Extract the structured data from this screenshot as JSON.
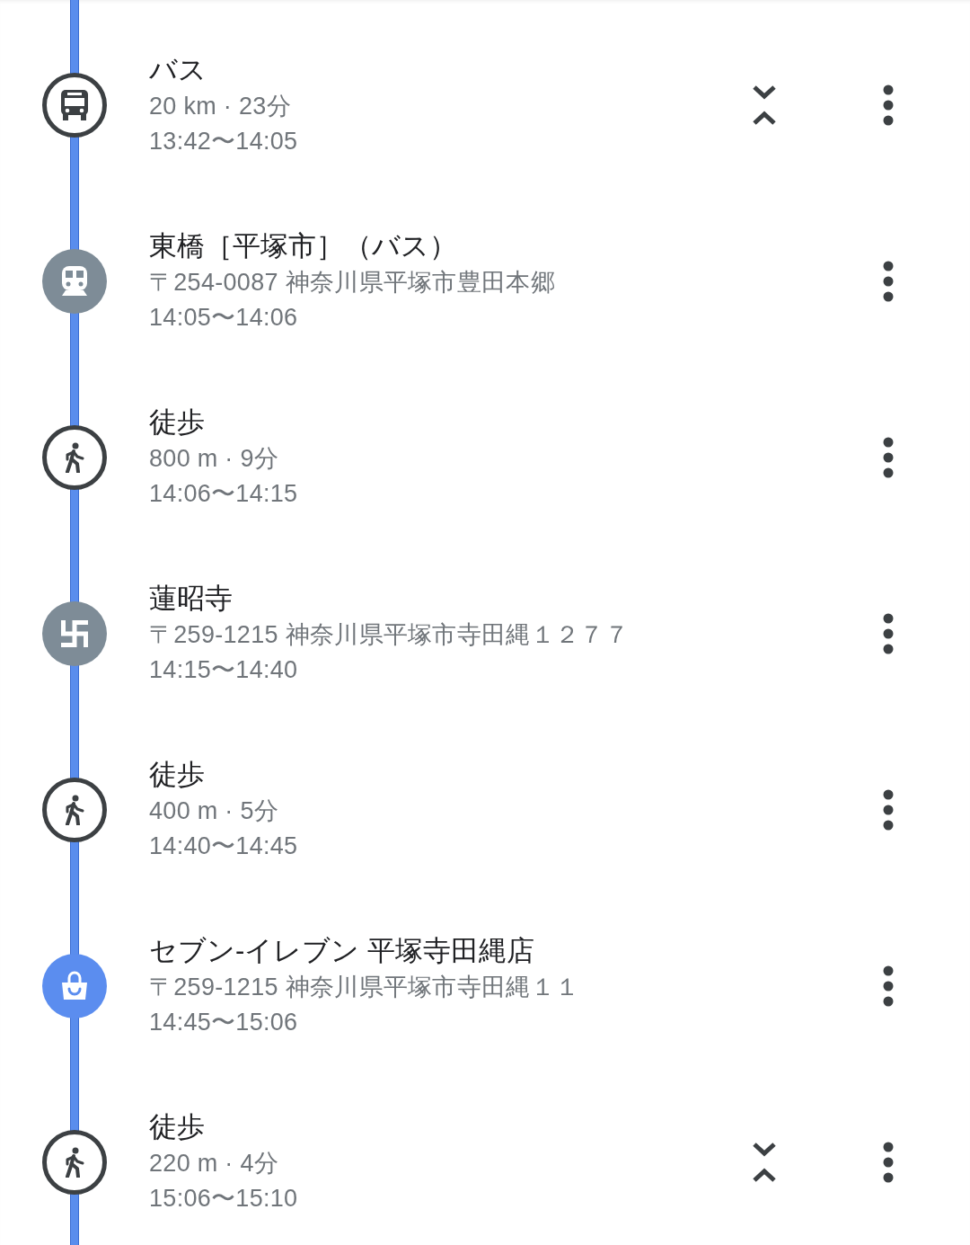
{
  "timeline": [
    {
      "kind": "bus",
      "title": "バス",
      "detail": "20 km · 23分",
      "time": "13:42〜14:05",
      "collapsible": true
    },
    {
      "kind": "station",
      "color": "#7e8c97",
      "title": "東橋［平塚市］（バス）",
      "detail": "〒254-0087 神奈川県平塚市豊田本郷",
      "time": "14:05〜14:06",
      "collapsible": false
    },
    {
      "kind": "walk",
      "title": "徒歩",
      "detail": "800 m · 9分",
      "time": "14:06〜14:15",
      "collapsible": false
    },
    {
      "kind": "temple",
      "color": "#7e8c97",
      "title": "蓮昭寺",
      "detail": "〒259-1215 神奈川県平塚市寺田縄１２７７",
      "time": "14:15〜14:40",
      "collapsible": false
    },
    {
      "kind": "walk",
      "title": "徒歩",
      "detail": "400 m · 5分",
      "time": "14:40〜14:45",
      "collapsible": false
    },
    {
      "kind": "shop",
      "color": "#5b8def",
      "title": "セブン-イレブン 平塚寺田縄店",
      "detail": "〒259-1215 神奈川県平塚市寺田縄１１",
      "time": "14:45〜15:06",
      "collapsible": false
    },
    {
      "kind": "walk",
      "title": "徒歩",
      "detail": "220 m · 4分",
      "time": "15:06〜15:10",
      "collapsible": true
    }
  ]
}
